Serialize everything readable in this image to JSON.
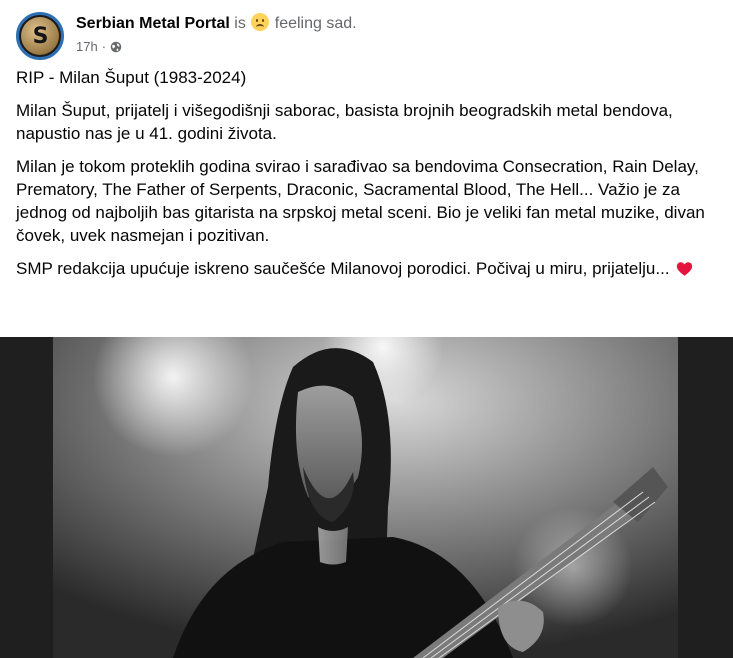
{
  "post": {
    "author": "Serbian Metal Portal",
    "is_text": "is",
    "feeling_text": "feeling sad.",
    "timestamp": "17h",
    "separator": "·",
    "privacy_icon": "globe-icon",
    "avatar_letter": "S",
    "paragraphs": [
      "RIP - Milan Šuput (1983-2024)",
      "Milan Šuput, prijatelj i višegodišnji saborac, basista brojnih beogradskih metal bendova, napustio nas je u 41. godini života.",
      "Milan je tokom proteklih godina svirao i sarađivao sa bendovima Consecration, Rain Delay, Prematory, The Father of Serpents, Draconic, Sacramental Blood, The Hell... Važio je za jednog od najboljih bas gitarista na srpskoj metal sceni. Bio je veliki fan metal muzike, divan čovek, uvek nasmejan i pozitivan.",
      "SMP redakcija upućuje iskreno saučešće Milanovoj porodici. Počivaj u miru, prijatelju..."
    ],
    "closing_emoji": "heart-icon"
  },
  "colors": {
    "text": "#050505",
    "muted": "#65676b",
    "avatar_ring": "#2f6fb3",
    "heart": "#e4143c",
    "photo_bg": "#1f1f1f"
  }
}
